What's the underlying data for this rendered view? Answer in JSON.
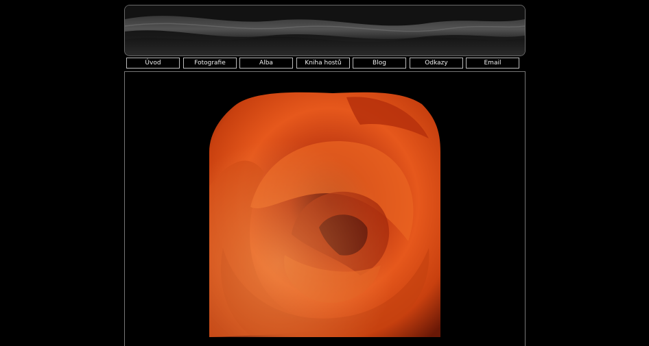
{
  "nav": {
    "items": [
      {
        "label": "Úvod"
      },
      {
        "label": "Fotografie"
      },
      {
        "label": "Alba"
      },
      {
        "label": "Kniha hostů"
      },
      {
        "label": "Blog"
      },
      {
        "label": "Odkazy"
      },
      {
        "label": "Email"
      }
    ]
  },
  "colors": {
    "background": "#000000",
    "nav_border": "#bdbdbd",
    "frame_border": "#777777",
    "rose_primary": "#e2531c",
    "rose_dark": "#7a1a08"
  }
}
